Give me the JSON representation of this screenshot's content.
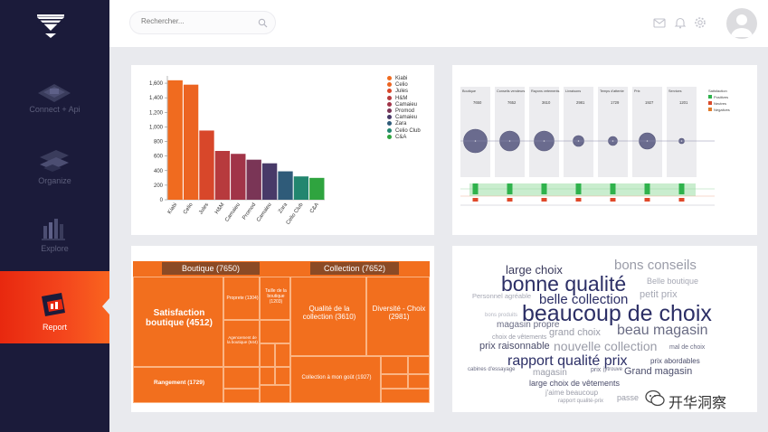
{
  "sidebar": {
    "items": [
      {
        "label": "Connect + Api",
        "icon": "connect-icon"
      },
      {
        "label": "Organize",
        "icon": "organize-icon"
      },
      {
        "label": "Explore",
        "icon": "explore-icon"
      },
      {
        "label": "Report",
        "icon": "report-icon",
        "active": true
      }
    ]
  },
  "search": {
    "placeholder": "Rechercher..."
  },
  "topbar": {
    "icons": [
      "mail-icon",
      "bell-icon",
      "gear-icon",
      "avatar"
    ]
  },
  "chart_data": {
    "type": "bar",
    "categories": [
      "Kiabi",
      "Celio",
      "Jules",
      "H&M",
      "Camaieu",
      "Promod",
      "Camaieu",
      "Zara",
      "Celio Club",
      "C&A"
    ],
    "values": [
      1640,
      1580,
      950,
      670,
      630,
      550,
      500,
      390,
      320,
      300
    ],
    "colors": [
      "#f06b1f",
      "#ec6421",
      "#d8472a",
      "#b73a3d",
      "#a13448",
      "#7a3556",
      "#483a68",
      "#2f5b79",
      "#22866f",
      "#2fa43f"
    ],
    "yticks": [
      0,
      200,
      400,
      600,
      800,
      "1,000",
      "1,200",
      "1,400",
      "1,600"
    ],
    "ylim": [
      0,
      1700
    ],
    "legend": [
      "Kiabi",
      "Celio",
      "Jules",
      "H&M",
      "Camaieu",
      "Promod",
      "Camaieu",
      "Zara",
      "Celio Club",
      "C&A"
    ]
  },
  "bubble_panel": {
    "columns": [
      {
        "title": "Boutique",
        "value": "7650"
      },
      {
        "title": "Conseils vendeurs",
        "value": "7652"
      },
      {
        "title": "Rayons vetements",
        "value": "3610"
      },
      {
        "title": "Livraisons",
        "value": "2981"
      },
      {
        "title": "Temps d'attente",
        "value": "1729"
      },
      {
        "title": "Prix",
        "value": "1927"
      },
      {
        "title": "Services",
        "value": "1201"
      }
    ],
    "legend": [
      "Satisfaction",
      "Positives",
      "Neutres",
      "Négatives"
    ],
    "legend_colors": [
      "#3a3a5c",
      "#2fb24c",
      "#d84a2a",
      "#e07b2a"
    ]
  },
  "treemap": {
    "groups": [
      {
        "title": "Boutique (7650)"
      },
      {
        "title": "Collection (7652)"
      }
    ],
    "cells": [
      {
        "label": "Satisfaction boutique (4512)"
      },
      {
        "label": "Proprete (1304)"
      },
      {
        "label": "Taille de la boutique (1203)"
      },
      {
        "label": "Agencement de la boutique (644)"
      },
      {
        "label": "Rangement (1729)"
      },
      {
        "label": "Qualité de la collection (3610)"
      },
      {
        "label": "Diversité - Choix (2981)"
      },
      {
        "label": "Collection à mon goût (1927)"
      }
    ]
  },
  "wordcloud": {
    "words": [
      {
        "text": "bons conseils",
        "color": "#9a9ca8"
      },
      {
        "text": "large choix",
        "color": "#3a3a5c"
      },
      {
        "text": "bonne qualité",
        "color": "#2c2f66"
      },
      {
        "text": "Belle boutique",
        "color": "#a6a8b4"
      },
      {
        "text": "petit prix",
        "color": "#a6a8b4"
      },
      {
        "text": "Personnel agréable",
        "color": "#a6a8b4"
      },
      {
        "text": "belle collection",
        "color": "#2c2f66"
      },
      {
        "text": "beaucoup de choix",
        "color": "#2c2f66"
      },
      {
        "text": "bons produits",
        "color": "#b5b7c2"
      },
      {
        "text": "magasin propre",
        "color": "#6a6c84"
      },
      {
        "text": "beau magasin",
        "color": "#6a6c84"
      },
      {
        "text": "grand choix",
        "color": "#9a9ca8"
      },
      {
        "text": "choix de vêtements",
        "color": "#9a9ca8"
      },
      {
        "text": "prix raisonnable",
        "color": "#4a4c6a"
      },
      {
        "text": "nouvelle collection",
        "color": "#9a9ca8"
      },
      {
        "text": "mal de choix",
        "color": "#6a6c84"
      },
      {
        "text": "rapport qualité prix",
        "color": "#2c2f66"
      },
      {
        "text": "prix abordables",
        "color": "#4a4c6a"
      },
      {
        "text": "cabines d'essayage",
        "color": "#6a6c84"
      },
      {
        "text": "magasin",
        "color": "#9a9ca8"
      },
      {
        "text": "prix",
        "color": "#6a6c84"
      },
      {
        "text": "jytrouve",
        "color": "#6a6c84"
      },
      {
        "text": "Grand magasin",
        "color": "#4a4c6a"
      },
      {
        "text": "large choix de vêtements",
        "color": "#4a4c6a"
      },
      {
        "text": "j'aime beaucoup",
        "color": "#9a9ca8"
      },
      {
        "text": "rapport qualité-prix",
        "color": "#9a9ca8"
      },
      {
        "text": "passe",
        "color": "#9a9ca8"
      }
    ]
  },
  "watermark": {
    "text": "开华洞察"
  }
}
